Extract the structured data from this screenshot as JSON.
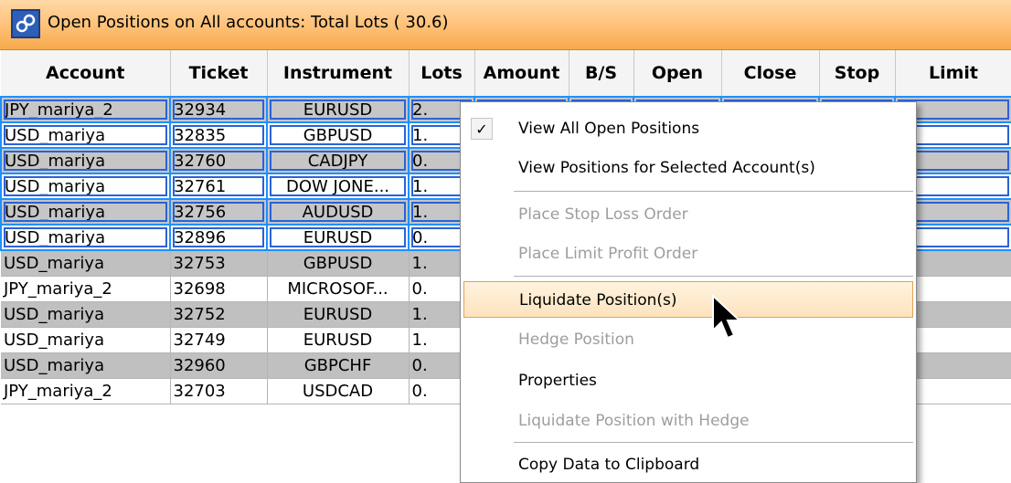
{
  "title": "Open Positions on All accounts: Total Lots ( 30.6)",
  "columns": [
    "Account",
    "Ticket",
    "Instrument",
    "Lots",
    "Amount",
    "B/S",
    "Open",
    "Close",
    "Stop",
    "Limit"
  ],
  "rows": [
    {
      "account": "JPY_mariya_2",
      "ticket": "32934",
      "instrument": "EURUSD",
      "lots": "2."
    },
    {
      "account": "USD_mariya",
      "ticket": "32835",
      "instrument": "GBPUSD",
      "lots": "1."
    },
    {
      "account": "USD_mariya",
      "ticket": "32760",
      "instrument": "CADJPY",
      "lots": "0."
    },
    {
      "account": "USD_mariya",
      "ticket": "32761",
      "instrument": "DOW JONE...",
      "lots": "1."
    },
    {
      "account": "USD_mariya",
      "ticket": "32756",
      "instrument": "AUDUSD",
      "lots": "1."
    },
    {
      "account": "USD_mariya",
      "ticket": "32896",
      "instrument": "EURUSD",
      "lots": "0."
    },
    {
      "account": "USD_mariya",
      "ticket": "32753",
      "instrument": "GBPUSD",
      "lots": "1."
    },
    {
      "account": "JPY_mariya_2",
      "ticket": "32698",
      "instrument": "MICROSOF...",
      "lots": "0."
    },
    {
      "account": "USD_mariya",
      "ticket": "32752",
      "instrument": "EURUSD",
      "lots": "1."
    },
    {
      "account": "USD_mariya",
      "ticket": "32749",
      "instrument": "EURUSD",
      "lots": "1."
    },
    {
      "account": "USD_mariya",
      "ticket": "32960",
      "instrument": "GBPCHF",
      "lots": "0."
    },
    {
      "account": "JPY_mariya_2",
      "ticket": "32703",
      "instrument": "USDCAD",
      "lots": "0."
    }
  ],
  "menu": {
    "check_mark": "✓",
    "items": [
      {
        "label": "View All Open Positions",
        "enabled": true,
        "checked": true
      },
      {
        "label": "View Positions for Selected Account(s)",
        "enabled": true
      },
      {
        "label": "Place Stop Loss Order",
        "enabled": false
      },
      {
        "label": "Place Limit Profit Order",
        "enabled": false
      },
      {
        "label": "Liquidate Position(s)",
        "enabled": true,
        "highlighted": true
      },
      {
        "label": "Hedge Position",
        "enabled": false
      },
      {
        "label": "Properties",
        "enabled": true
      },
      {
        "label": "Liquidate Position with Hedge",
        "enabled": false
      },
      {
        "label": "Copy Data to Clipboard",
        "enabled": true
      }
    ]
  },
  "colors": {
    "title_bar": "#ffc27a",
    "row_alt": "#c0c0c0",
    "selection_border": "#1e90ff",
    "menu_highlight": "#fde3bd"
  },
  "icons": {
    "title": "link-chain-icon",
    "cursor": "arrow-cursor-icon"
  }
}
